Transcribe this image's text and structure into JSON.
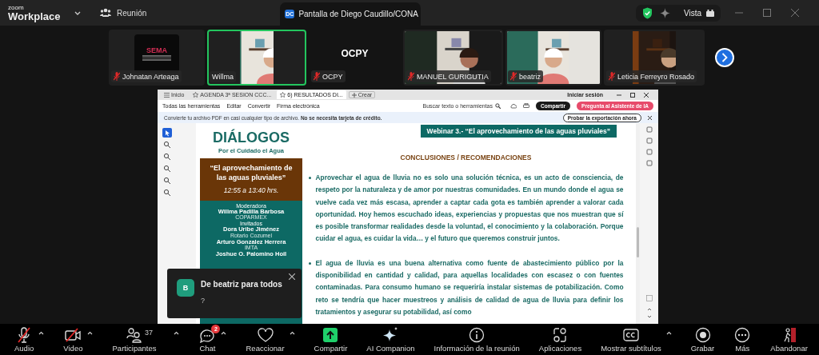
{
  "app": {
    "brand_small": "zoom",
    "brand": "Workplace",
    "meeting": "Reunión"
  },
  "share_tab": {
    "badge": "DC",
    "title": "Pantalla de Diego Caudillo/CONA"
  },
  "view_button": {
    "label": "Vista"
  },
  "participants": [
    {
      "name": "Johnatan Arteaga",
      "kind": "logo",
      "tile_text": "SEMA",
      "muted": true,
      "speaking": false
    },
    {
      "name": "Willma",
      "kind": "video",
      "muted": false,
      "speaking": true
    },
    {
      "name": "OCPY",
      "kind": "text",
      "tile_text": "OCPY",
      "muted": true,
      "speaking": false
    },
    {
      "name": "MANUEL GURIGUTIA",
      "kind": "video",
      "muted": true,
      "speaking": false
    },
    {
      "name": "beatriz",
      "kind": "video",
      "muted": true,
      "speaking": false
    },
    {
      "name": "Leticia Ferreyro Rosado",
      "kind": "video",
      "muted": true,
      "speaking": false
    }
  ],
  "viewer": {
    "tabs": [
      {
        "label": "Inicio",
        "kind": "home",
        "selected": false
      },
      {
        "label": "AGENDA 3ª SESION CCC...",
        "kind": "doc",
        "selected": false
      },
      {
        "label": "6) RESULTADOS DI...",
        "kind": "doc",
        "selected": true
      }
    ],
    "new_tab": "Crear",
    "sign_in": "Iniciar sesión",
    "menu": [
      "Todas las herramientas",
      "Editar",
      "Convertir",
      "Firma electrónica"
    ],
    "search_placeholder": "Buscar texto o herramientas",
    "share": "Compartir",
    "ai_button": "Pregunta al Asistente de IA",
    "banner": {
      "text": "Convierte tu archivo PDF en casi cualquier tipo de archivo. **No se necesita tarjeta de crédito.**",
      "button": "Probar la exportación ahora"
    }
  },
  "document": {
    "title": "DIÁLOGOS",
    "subtitle": "Por el Cuidado el Agua",
    "event_title": "“El aprovechamiento de las aguas pluviales”",
    "time": "12:55 a 13:40 hrs.",
    "people": [
      {
        "role": "Moderadora",
        "name": "Willma Padilla Barbosa",
        "org": "COPARMEX"
      },
      {
        "role": "Invitados",
        "name": "Dora Uribe Jiménez",
        "org": "Rotario Cozumel"
      },
      {
        "name": "Arturo Gonzalez Herrera",
        "org": "IMTA"
      },
      {
        "name": "Joshue O. Palomino Hoil"
      }
    ],
    "header": "Webinar 3.- “El aprovechamiento de las aguas pluviales”",
    "heading": "CONCLUSIONES / RECOMENDACIONES",
    "bullets": [
      "Aprovechar el agua de lluvia no es solo una solución técnica, es un acto de consciencia, de respeto por la naturaleza y de amor por nuestras comunidades. En un mundo donde el agua se vuelve cada vez más escasa, aprender a captar cada gota es también aprender a valorar cada oportunidad. Hoy hemos escuchado ideas, experiencias y propuestas que nos muestran que sí es posible transformar realidades desde la voluntad, el conocimiento y la colaboración. Porque cuidar el agua, es cuidar la vida… y el futuro que queremos construir juntos.",
      "El agua de lluvia es una buena alternativa como fuente de abastecimiento público por la disponibilidad en cantidad y calidad, para aquellas localidades con escasez o con fuentes contaminadas. Para consumo humano se requeriría instalar sistemas de potabilización. Como reto se tendría que hacer muestreos y análisis de calidad de agua de lluvia para definir los tratamientos y asegurar su potabilidad, así como"
    ]
  },
  "toast": {
    "avatar": "B",
    "title": "De beatriz para todos",
    "message": "?"
  },
  "toolbar": [
    {
      "label": "Audio",
      "kind": "mic",
      "muted": true,
      "caret": true
    },
    {
      "label": "Video",
      "kind": "camera",
      "muted": true,
      "caret": true
    },
    {
      "label": "Participantes",
      "kind": "people",
      "count": "37",
      "caret": true
    },
    {
      "label": "Chat",
      "kind": "chat",
      "badge": "2",
      "caret": true
    },
    {
      "label": "Reaccionar",
      "kind": "heart",
      "caret": true
    },
    {
      "label": "Compartir",
      "kind": "share",
      "caret": false
    },
    {
      "label": "AI Companion",
      "kind": "sparkle",
      "caret": false
    },
    {
      "label": "Información de la reunión",
      "kind": "info",
      "caret": false
    },
    {
      "label": "Aplicaciones",
      "kind": "apps",
      "caret": false
    },
    {
      "label": "Mostrar subtítulos",
      "kind": "cc",
      "caret": true
    },
    {
      "label": "Grabar",
      "kind": "record",
      "caret": false
    },
    {
      "label": "Más",
      "kind": "more",
      "caret": false
    },
    {
      "label": "Abandonar",
      "kind": "leave",
      "caret": false
    }
  ]
}
